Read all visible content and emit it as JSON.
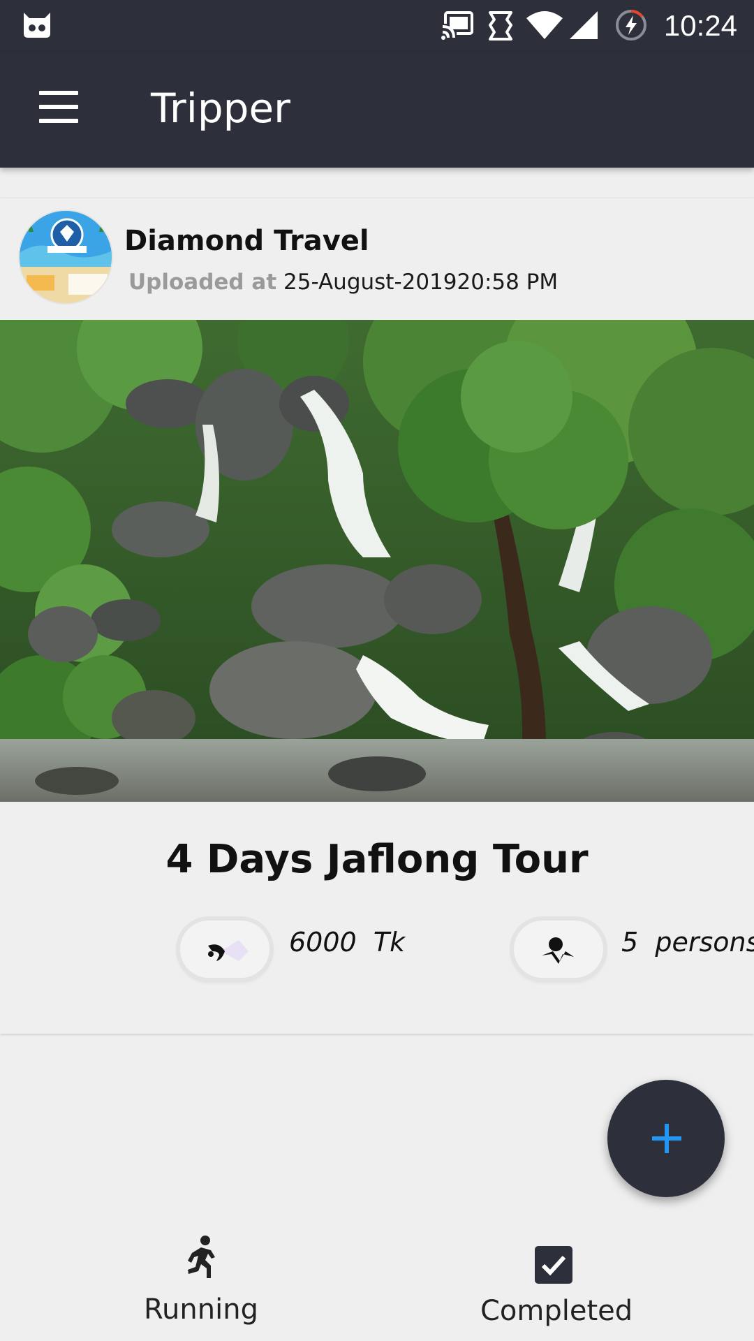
{
  "status_bar": {
    "time": "10:24",
    "icons": [
      "cyanogen-icon",
      "cast-icon",
      "sync-icon",
      "wifi-icon",
      "signal-icon",
      "battery-charging-icon"
    ]
  },
  "app_bar": {
    "title": "Tripper",
    "menu_icon": "hamburger-menu-icon"
  },
  "card": {
    "agency_name": "Diamond Travel",
    "uploaded_label": "Uploaded at",
    "uploaded_date": "25-August-201920:58 PM",
    "image_subject": "waterfall",
    "tour_title": "4 Days Jaflong Tour",
    "price_value": "6000",
    "price_unit": "Tk",
    "persons_value": "5",
    "persons_unit": "persons"
  },
  "fab": {
    "icon": "plus-icon"
  },
  "bottom_nav": {
    "items": [
      {
        "label": "Running",
        "icon": "running-person-icon"
      },
      {
        "label": "Completed",
        "icon": "checkbox-checked-icon"
      }
    ]
  },
  "colors": {
    "app_bar": "#2d303b",
    "background": "#efefef",
    "fab_accent": "#2196f3"
  }
}
